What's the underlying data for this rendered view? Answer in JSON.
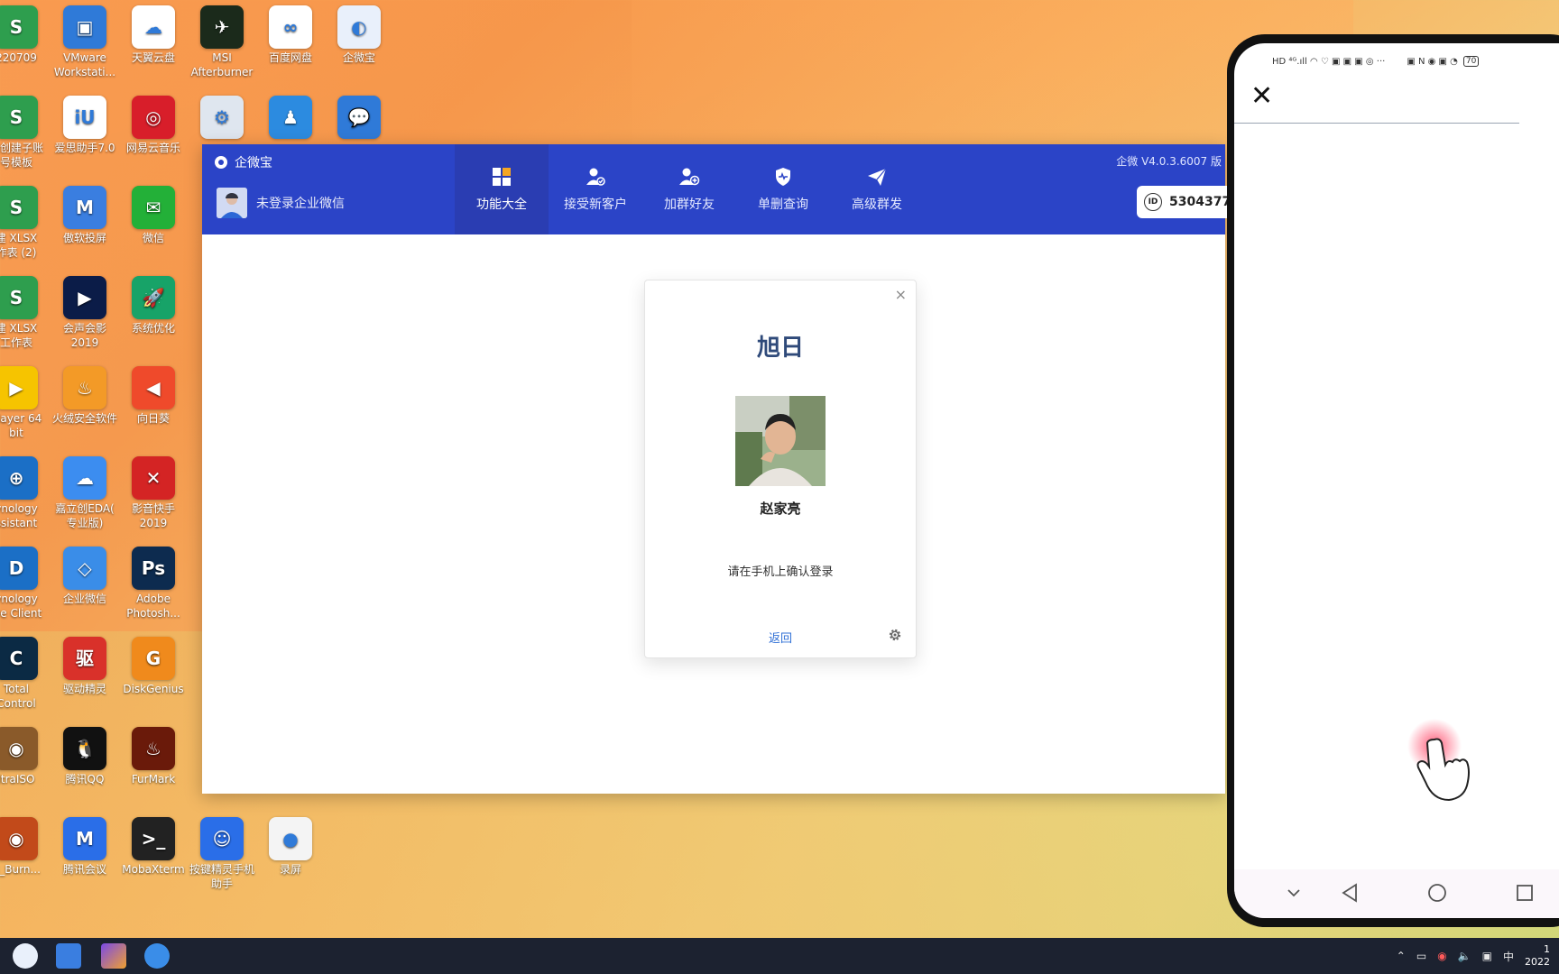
{
  "desktop_icons": [
    {
      "label": "220709",
      "color": "#2e9e4e",
      "glyph": "S"
    },
    {
      "label": "VMware\nWorkstati...",
      "color": "#2f7ad8",
      "glyph": "▣"
    },
    {
      "label": "天翼云盘",
      "color": "#ffffff",
      "glyph": "☁"
    },
    {
      "label": "MSI\nAfterburner",
      "color": "#1b2a1b",
      "glyph": "✈"
    },
    {
      "label": "百度网盘",
      "color": "#ffffff",
      "glyph": "∞"
    },
    {
      "label": "企微宝",
      "color": "#e9f0fb",
      "glyph": "◐"
    },
    {
      "label": "建创建子账\n号模板",
      "color": "#2e9e4e",
      "glyph": "S"
    },
    {
      "label": "爱思助手7.0",
      "color": "#ffffff",
      "glyph": "iU"
    },
    {
      "label": "网易云音乐",
      "color": "#d81e2a",
      "glyph": "◎"
    },
    {
      "label": "",
      "color": "#dfe6ef",
      "glyph": "⚙"
    },
    {
      "label": "",
      "color": "#2c8be0",
      "glyph": "♟"
    },
    {
      "label": "",
      "color": "#2f7ad8",
      "glyph": "💬"
    },
    {
      "label": "建 XLSX\n作表 (2)",
      "color": "#2e9e4e",
      "glyph": "S"
    },
    {
      "label": "傲软投屏",
      "color": "#3a7ee0",
      "glyph": "M"
    },
    {
      "label": "微信",
      "color": "#23b038",
      "glyph": "✉"
    },
    {
      "label": "建 XLSX\n工作表",
      "color": "#2e9e4e",
      "glyph": "S"
    },
    {
      "label": "会声会影\n2019",
      "color": "#0b1c48",
      "glyph": "▶"
    },
    {
      "label": "系统优化",
      "color": "#17a368",
      "glyph": "🚀"
    },
    {
      "label": "Player 64\nbit",
      "color": "#f6c400",
      "glyph": "▶"
    },
    {
      "label": "火绒安全软件",
      "color": "#f39a27",
      "glyph": "♨"
    },
    {
      "label": "向日葵",
      "color": "#ef4a2b",
      "glyph": "◀"
    },
    {
      "label": "ynology\nssistant",
      "color": "#1b6fc6",
      "glyph": "⊕"
    },
    {
      "label": "嘉立创EDA(\n专业版)",
      "color": "#3c8df0",
      "glyph": "☁"
    },
    {
      "label": "影音快手\n2019",
      "color": "#d42424",
      "glyph": "✕"
    },
    {
      "label": "ynology\nive Client",
      "color": "#1b6fc6",
      "glyph": "D"
    },
    {
      "label": "企业微信",
      "color": "#3a8de8",
      "glyph": "◇"
    },
    {
      "label": "Adobe\nPhotosh...",
      "color": "#0d2b4f",
      "glyph": "Ps"
    },
    {
      "label": "Total\nControl",
      "color": "#0b2a44",
      "glyph": "C"
    },
    {
      "label": "驱动精灵",
      "color": "#d9312a",
      "glyph": "驱"
    },
    {
      "label": "DiskGenius",
      "color": "#f08a1c",
      "glyph": "G"
    },
    {
      "label": "ltraISO",
      "color": "#8a5a2a",
      "glyph": "◉"
    },
    {
      "label": "腾讯QQ",
      "color": "#111111",
      "glyph": "🐧"
    },
    {
      "label": "FurMark",
      "color": "#6a1a0a",
      "glyph": "♨"
    },
    {
      "label": "B_Burn...",
      "color": "#c24a1a",
      "glyph": "◉"
    },
    {
      "label": "腾讯会议",
      "color": "#2a6ee8",
      "glyph": "M"
    },
    {
      "label": "MobaXterm",
      "color": "#222222",
      "glyph": ">_"
    },
    {
      "label": "按键精灵手机\n助手",
      "color": "#2a6ee8",
      "glyph": "☺"
    },
    {
      "label": "录屏",
      "color": "#f4f4f4",
      "glyph": "●"
    }
  ],
  "app": {
    "title": "企微宝",
    "user_status": "未登录企业微信",
    "version": "企微 V4.0.3.6007  版",
    "id_label": "ID",
    "id_value": "5304377-",
    "tabs": [
      {
        "label": "功能大全",
        "icon": "grid-icon",
        "active": true
      },
      {
        "label": "接受新客户",
        "icon": "user-check-icon",
        "active": false
      },
      {
        "label": "加群好友",
        "icon": "user-add-icon",
        "active": false
      },
      {
        "label": "单删查询",
        "icon": "shield-icon",
        "active": false
      },
      {
        "label": "高级群发",
        "icon": "send-icon",
        "active": false
      }
    ]
  },
  "dialog": {
    "close_glyph": "×",
    "corp_name": "旭日",
    "user_name": "赵家亮",
    "message": "请在手机上确认登录",
    "back_label": "返回"
  },
  "phone": {
    "status_left": "HD ⁴ᴳ.ıll ◠ ♡ ▣ ▣ ▣ ◎ ···",
    "status_right": "▣ N ◉ ▣ ◔",
    "battery": "70",
    "close_glyph": "✕"
  },
  "colors": {
    "header": "#2b44c7",
    "header_active_tab": "#2a3db2",
    "link": "#2f6fd6",
    "corp_name": "#2f4a7a"
  }
}
